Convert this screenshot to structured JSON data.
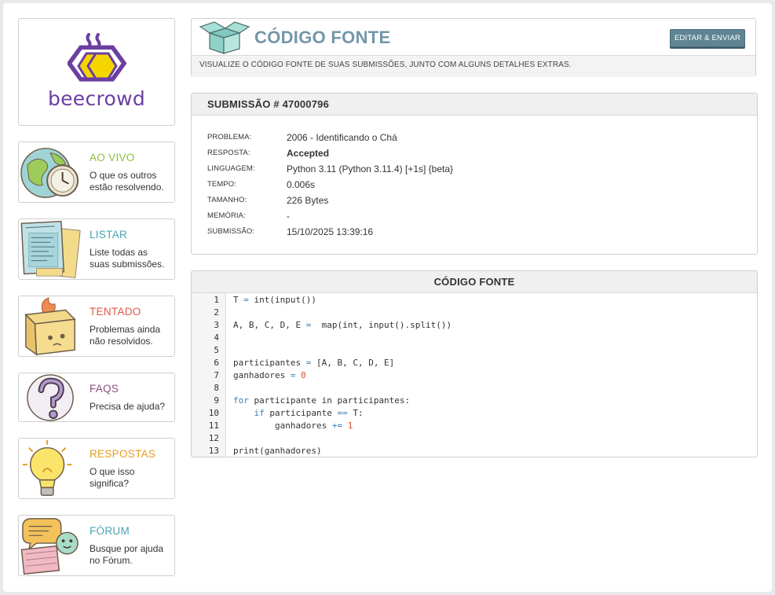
{
  "sidebar": {
    "logo_text": "beecrowd",
    "items": [
      {
        "title": "AO VIVO",
        "desc": [
          "O que os outros",
          "estão resolvendo."
        ],
        "color": "#8bbf3a"
      },
      {
        "title": "LISTAR",
        "desc": [
          "Liste todas as",
          "suas submissões."
        ],
        "color": "#46a3b5"
      },
      {
        "title": "TENTADO",
        "desc": [
          "Problemas ainda",
          "não resolvidos."
        ],
        "color": "#e0564a"
      },
      {
        "title": "FAQS",
        "desc": [
          "Precisa de ajuda?"
        ],
        "color": "#8a4e7e"
      },
      {
        "title": "RESPOSTAS",
        "desc": [
          "O que isso",
          "significa?"
        ],
        "color": "#e79b1d"
      },
      {
        "title": "FÓRUM",
        "desc": [
          "Busque por ajuda",
          "no Fórum."
        ],
        "color": "#46a3b5"
      }
    ]
  },
  "header": {
    "title": "CÓDIGO FONTE",
    "button_label": "EDITAR & ENVIAR",
    "subtitle": "VISUALIZE O CÓDIGO FONTE DE SUAS SUBMISSÕES, JUNTO COM ALGUNS DETALHES EXTRAS."
  },
  "submission": {
    "heading": "SUBMISSÃO # 47000796",
    "details": [
      {
        "label": "PROBLEMA:",
        "value": "2006 - Identificando o Chá"
      },
      {
        "label": "RESPOSTA:",
        "value": "Accepted"
      },
      {
        "label": "LINGUAGEM:",
        "value": "Python 3.11 (Python 3.11.4) [+1s] {beta}"
      },
      {
        "label": "TEMPO:",
        "value": "0.006s"
      },
      {
        "label": "TAMANHO:",
        "value": "226 Bytes"
      },
      {
        "label": "MEMÓRIA:",
        "value": "-"
      },
      {
        "label": "SUBMISSÃO:",
        "value": "15/10/2025 13:39:16"
      }
    ]
  },
  "code": {
    "heading": "CÓDIGO FONTE",
    "lines": [
      [
        [
          "",
          "T "
        ],
        [
          "op",
          "="
        ],
        [
          "",
          " int(input())"
        ]
      ],
      [],
      [
        [
          "",
          "A, B, C, D, E "
        ],
        [
          "op",
          "="
        ],
        [
          "",
          "  map(int, input().split())"
        ]
      ],
      [],
      [],
      [
        [
          "",
          "participantes "
        ],
        [
          "op",
          "="
        ],
        [
          "",
          " [A, B, C, D, E]"
        ]
      ],
      [
        [
          "",
          "ganhadores "
        ],
        [
          "op",
          "="
        ],
        [
          "",
          " "
        ],
        [
          "num",
          "0"
        ]
      ],
      [],
      [
        [
          "kw",
          "for"
        ],
        [
          "",
          " participante in participantes:"
        ]
      ],
      [
        [
          "",
          "    "
        ],
        [
          "kw",
          "if"
        ],
        [
          "",
          " participante "
        ],
        [
          "op",
          "=="
        ],
        [
          "",
          " T:"
        ]
      ],
      [
        [
          "",
          "        ganhadores "
        ],
        [
          "op",
          "+="
        ],
        [
          "",
          " "
        ],
        [
          "num",
          "1"
        ]
      ],
      [],
      [
        [
          "",
          "print(ganhadores)"
        ]
      ]
    ]
  }
}
